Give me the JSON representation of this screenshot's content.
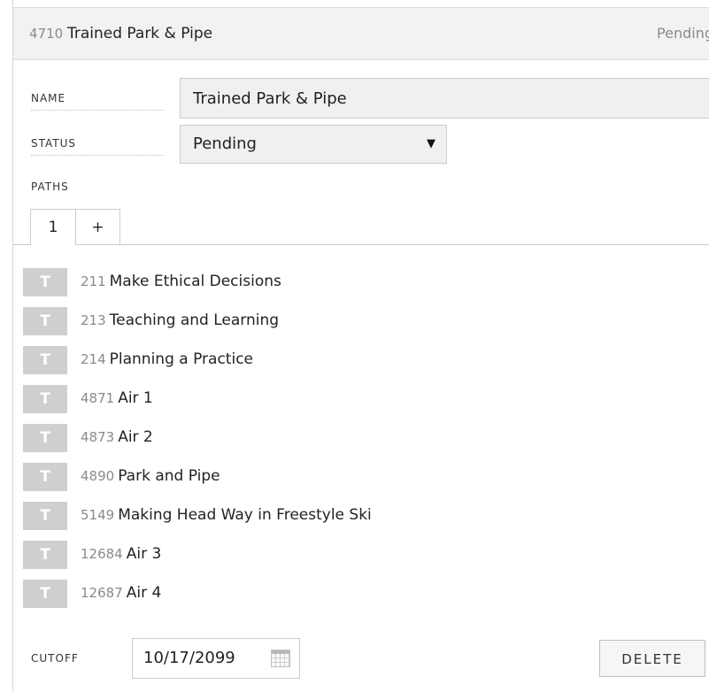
{
  "header": {
    "id": "4710",
    "title": "Trained Park & Pipe",
    "status": "Pending"
  },
  "form": {
    "name_label": "NAME",
    "name_value": "Trained Park & Pipe",
    "status_label": "STATUS",
    "status_value": "Pending",
    "paths_label": "PATHS"
  },
  "tabs": [
    {
      "label": "1",
      "active": true
    },
    {
      "label": "+",
      "active": false
    }
  ],
  "paths": [
    {
      "badge": "T",
      "id": "211",
      "title": "Make Ethical Decisions"
    },
    {
      "badge": "T",
      "id": "213",
      "title": "Teaching and Learning"
    },
    {
      "badge": "T",
      "id": "214",
      "title": "Planning a Practice"
    },
    {
      "badge": "T",
      "id": "4871",
      "title": "Air 1"
    },
    {
      "badge": "T",
      "id": "4873",
      "title": "Air 2"
    },
    {
      "badge": "T",
      "id": "4890",
      "title": "Park and Pipe"
    },
    {
      "badge": "T",
      "id": "5149",
      "title": "Making Head Way in Freestyle Ski"
    },
    {
      "badge": "T",
      "id": "12684",
      "title": "Air 3"
    },
    {
      "badge": "T",
      "id": "12687",
      "title": "Air 4"
    }
  ],
  "footer": {
    "cutoff_label": "CUTOFF",
    "cutoff_value": "10/17/2099",
    "delete_label": "DELETE"
  },
  "colors": {
    "badge_bg": "#cfcfcf",
    "header_bg": "#f2f2f2",
    "input_bg": "#f0f0f0"
  },
  "icons": {
    "status_dropdown": "triangle-down-icon",
    "cutoff_picker": "calendar-icon"
  }
}
